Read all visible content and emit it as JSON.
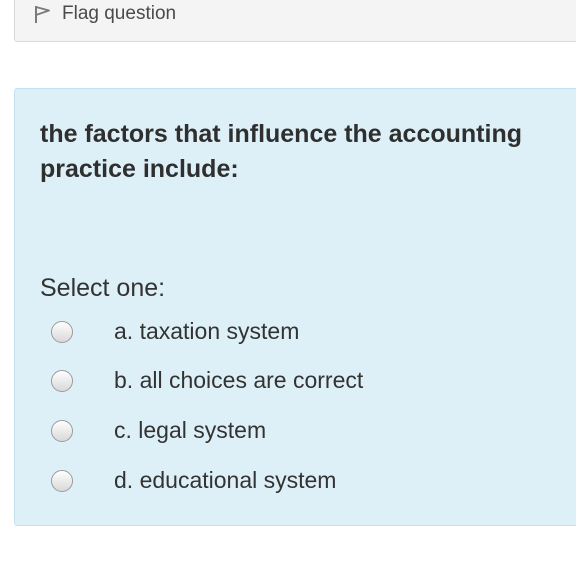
{
  "flag": {
    "label": "Flag question",
    "icon": "flag-icon"
  },
  "question": {
    "text": "the factors that influence the accounting practice include:",
    "prompt": "Select one:",
    "answers": [
      {
        "label": "a.  taxation system"
      },
      {
        "label": "b. all choices are correct"
      },
      {
        "label": "c. legal system"
      },
      {
        "label": "d. educational system"
      }
    ]
  },
  "colors": {
    "panel_background": "#def0f7",
    "panel_border": "#c4e1ee",
    "flag_background": "#f4f4f4"
  }
}
